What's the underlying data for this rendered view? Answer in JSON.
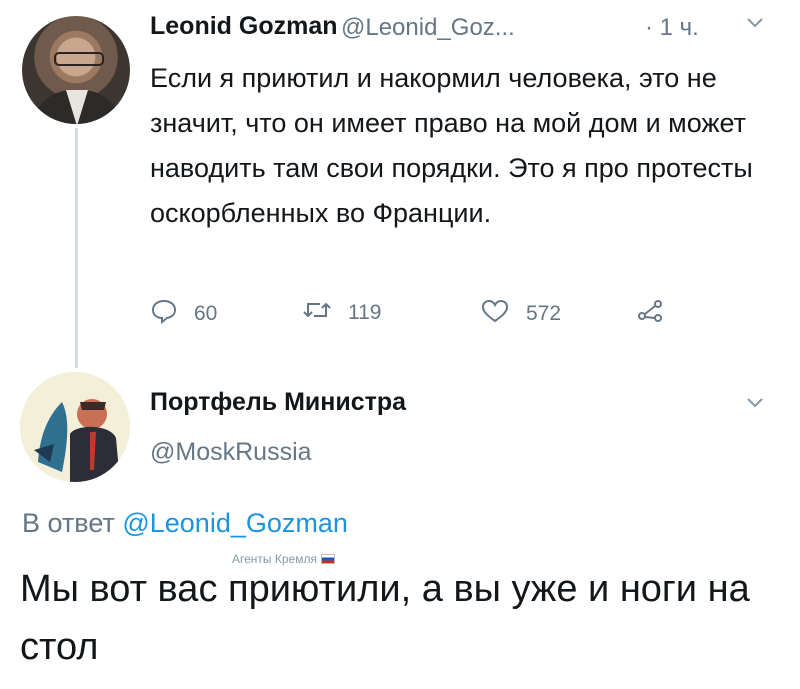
{
  "tweet1": {
    "author_name": "Leonid Gozman",
    "handle": "@Leonid_Goz...",
    "time": "· 1 ч.",
    "text": "Если я приютил и накормил человека, это не значит, что он имеет право на мой дом и может наводить там свои порядки. Это я про протесты оскорбленных во Франции.",
    "actions": {
      "replies": "60",
      "retweets": "119",
      "likes": "572"
    }
  },
  "tweet2": {
    "author_name": "Портфель Министра",
    "handle": "@MoskRussia",
    "reply_prefix": "В ответ",
    "reply_mention": "@Leonid_Gozman",
    "text": "Мы вот вас приютили, а вы уже и ноги на стол"
  },
  "watermark": {
    "text": "Агенты Кремля"
  },
  "colors": {
    "text": "#14171a",
    "secondary": "#657786",
    "link": "#1b95e0",
    "thread_line": "#d5dbe0"
  }
}
